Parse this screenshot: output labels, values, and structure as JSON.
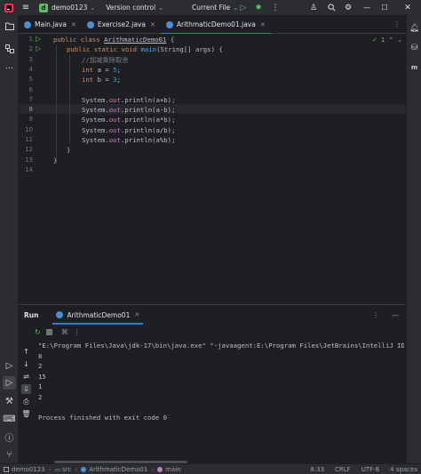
{
  "titlebar": {
    "project_initial": "d",
    "project_name": "demo0123",
    "vcs": "Version control",
    "run_config": "Current File"
  },
  "tabs": [
    {
      "label": "Main.java",
      "color": "#4d8fd6"
    },
    {
      "label": "Exercise2.java",
      "color": "#4d8fd6"
    },
    {
      "label": "ArithmaticDemo01.java",
      "color": "#4d8fd6"
    }
  ],
  "editor": {
    "line_numbers": [
      "1",
      "2",
      "3",
      "4",
      "5",
      "6",
      "7",
      "8",
      "9",
      "10",
      "11",
      "12",
      "13",
      "14"
    ],
    "current_line": "8",
    "inspection_count": "1",
    "code": {
      "l1_kw": "public class ",
      "l1_name": "ArithmaticDemo01",
      "l1_rest": " {",
      "l2_kw": "public static void ",
      "l2_fn": "main",
      "l2_rest": "(String[] args) {",
      "l3_cmt": "//加减乘除取余",
      "l4_kw": "int ",
      "l4_rest": "a = ",
      "l4_num": "5",
      "l5_kw": "int ",
      "l5_rest": "b = ",
      "l5_num": "3",
      "sys": "System.",
      "out": "out",
      "l7_call": ".println(a+b);",
      "l8_call": ".println(a-b);",
      "l9_call": ".println(a*b);",
      "l10_call": ".println(a/b);",
      "l11_call": ".println(a%b);",
      "close_inner": "}",
      "close_outer": "}"
    }
  },
  "run": {
    "label": "Run",
    "tab": "ArithmaticDemo01",
    "console": [
      "\"E:\\Program Files\\Java\\jdk-17\\bin\\java.exe\" \"-javaagent:E:\\Program Files\\JetBrains\\IntelliJ IDEA 2023.",
      "8",
      "2",
      "15",
      "1",
      "2",
      "",
      "Process finished with exit code 0"
    ]
  },
  "statusbar": {
    "crumbs": [
      "demo0123",
      "src",
      "ArithmaticDemo01",
      "main"
    ],
    "position": "8:33",
    "line_sep": "CRLF",
    "encoding": "UTF-8",
    "indent": "4 spaces"
  }
}
